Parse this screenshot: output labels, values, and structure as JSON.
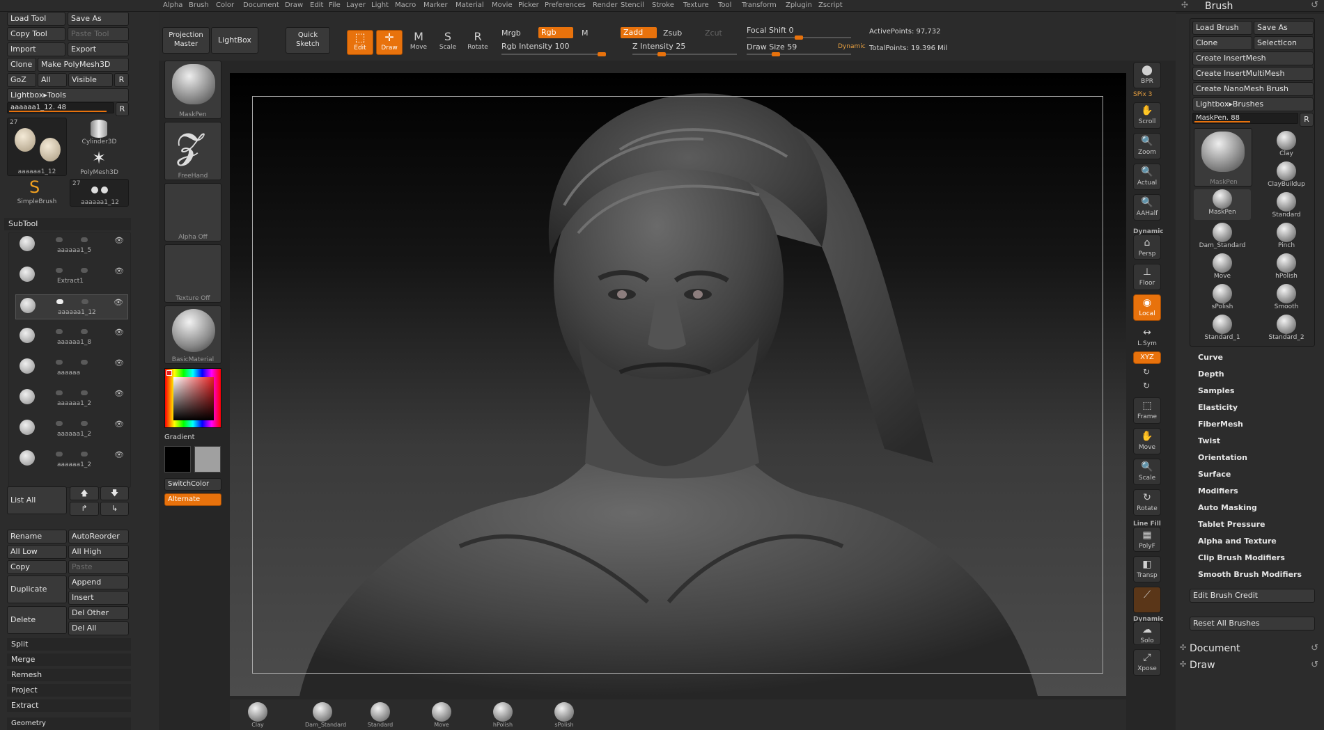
{
  "menu": [
    "Alpha",
    "Brush",
    "Color",
    "Document",
    "Draw",
    "Edit",
    "File",
    "Layer",
    "Light",
    "Macro",
    "Marker",
    "Material",
    "Movie",
    "Picker",
    "Preferences",
    "Render",
    "Stencil",
    "Stroke",
    "Texture",
    "Tool",
    "Transform",
    "Zplugin",
    "Zscript"
  ],
  "tool": {
    "load": "Load Tool",
    "save_as": "Save As",
    "copy": "Copy Tool",
    "paste": "Paste Tool",
    "import": "Import",
    "export": "Export",
    "clone": "Clone",
    "make_polymesh": "Make PolyMesh3D",
    "goz": "GoZ",
    "all": "All",
    "visible": "Visible",
    "r": "R",
    "lightbox": "Lightbox▸Tools",
    "slider": "aaaaaa1_12. 48",
    "tools": [
      {
        "count": "27",
        "name": "aaaaaa1_12"
      },
      {
        "name": "Cylinder3D"
      },
      {
        "name": "PolyMesh3D"
      },
      {
        "name": "SimpleBrush"
      },
      {
        "count": "27",
        "name": "aaaaaa1_12"
      }
    ]
  },
  "subtool": {
    "title": "SubTool",
    "items": [
      "aaaaaa1_5",
      "Extract1",
      "aaaaaa1_12",
      "aaaaaa1_8",
      "aaaaaa",
      "aaaaaa1_2",
      "aaaaaa1_2",
      "aaaaaa1_2"
    ],
    "list_all": "List All",
    "rename": "Rename",
    "autoreorder": "AutoReorder",
    "all_low": "All Low",
    "all_high": "All High",
    "copy": "Copy",
    "paste": "Paste",
    "duplicate": "Duplicate",
    "append": "Append",
    "insert": "Insert",
    "delete": "Delete",
    "del_other": "Del Other",
    "del_all": "Del All",
    "sections": [
      "Split",
      "Merge",
      "Remesh",
      "Project",
      "Extract"
    ],
    "geometry": "Geometry"
  },
  "toolbar": {
    "projection_master": "Projection Master",
    "lightbox": "LightBox",
    "quick_sketch": "Quick Sketch",
    "edit": "Edit",
    "draw": "Draw",
    "move": "Move",
    "scale": "Scale",
    "rotate": "Rotate",
    "mrgb": "Mrgb",
    "rgb": "Rgb",
    "m": "M",
    "zadd": "Zadd",
    "zsub": "Zsub",
    "zcut": "Zcut",
    "rgb_intensity": "Rgb Intensity 100",
    "z_intensity": "Z Intensity 25",
    "focal_shift": "Focal Shift 0",
    "draw_size": "Draw Size 59",
    "dynamic": "Dynamic",
    "active_points": "ActivePoints: 97,732",
    "total_points": "TotalPoints: 19.396 Mil"
  },
  "leftshelf": {
    "maskpen": "MaskPen",
    "freehand": "FreeHand",
    "alpha_off": "Alpha Off",
    "texture_off": "Texture Off",
    "basic_material": "BasicMaterial",
    "gradient": "Gradient",
    "switch_color": "SwitchColor",
    "alternate": "Alternate"
  },
  "rightshelf": [
    {
      "g": "⬤",
      "l": "BPR"
    },
    {
      "g": "✋",
      "l": "Scroll"
    },
    {
      "g": "🔍",
      "l": "Zoom"
    },
    {
      "g": "🔍",
      "l": "Actual"
    },
    {
      "g": "🔍",
      "l": "AAHalf"
    },
    {
      "g": "⌂",
      "l": "Persp"
    },
    {
      "g": "⊥",
      "l": "Floor"
    },
    {
      "g": "◉",
      "l": "Local"
    },
    {
      "g": "↔",
      "l": "L.Sym"
    },
    {
      "g": "XYZ",
      "l": ""
    },
    {
      "g": "⬚",
      "l": "Frame"
    },
    {
      "g": "✋",
      "l": "Move"
    },
    {
      "g": "🔍",
      "l": "Scale"
    },
    {
      "g": "↻",
      "l": "Rotate"
    },
    {
      "g": "▦",
      "l": "PolyF"
    },
    {
      "g": "◧",
      "l": "Transp"
    },
    {
      "g": "",
      "l": ""
    },
    {
      "g": "☁",
      "l": "Solo"
    },
    {
      "g": "⤢",
      "l": "Xpose"
    }
  ],
  "spix": "SPix 3",
  "dynamic_label": "Dynamic",
  "line_fill": "Line Fill",
  "brush": {
    "title": "Brush",
    "load": "Load Brush",
    "save_as": "Save As",
    "clone": "Clone",
    "select_icon": "SelectIcon",
    "create_insertmesh": "Create InsertMesh",
    "create_insertmultimesh": "Create InsertMultiMesh",
    "create_nanomesh": "Create NanoMesh Brush",
    "lightbox": "Lightbox▸Brushes",
    "slider": "MaskPen. 88",
    "r": "R",
    "cells": [
      "Clay",
      "ClayBuildup",
      "MaskPen",
      "Standard",
      "Dam_Standard",
      "Pinch",
      "Move",
      "hPolish",
      "sPolish",
      "Smooth",
      "Standard_1",
      "Standard_2"
    ],
    "current": "MaskPen",
    "menus": [
      "Curve",
      "Depth",
      "Samples",
      "Elasticity",
      "FiberMesh",
      "Twist",
      "Orientation",
      "Surface",
      "Modifiers",
      "Auto Masking",
      "Tablet Pressure",
      "Alpha and Texture",
      "Clip Brush Modifiers",
      "Smooth Brush Modifiers"
    ],
    "edit_credit": "Edit Brush Credit",
    "reset_all": "Reset All Brushes",
    "document": "Document",
    "draw": "Draw"
  },
  "bottom": [
    "Clay",
    "Dam_Standard",
    "Standard",
    "Move",
    "hPolish",
    "sPolish"
  ]
}
